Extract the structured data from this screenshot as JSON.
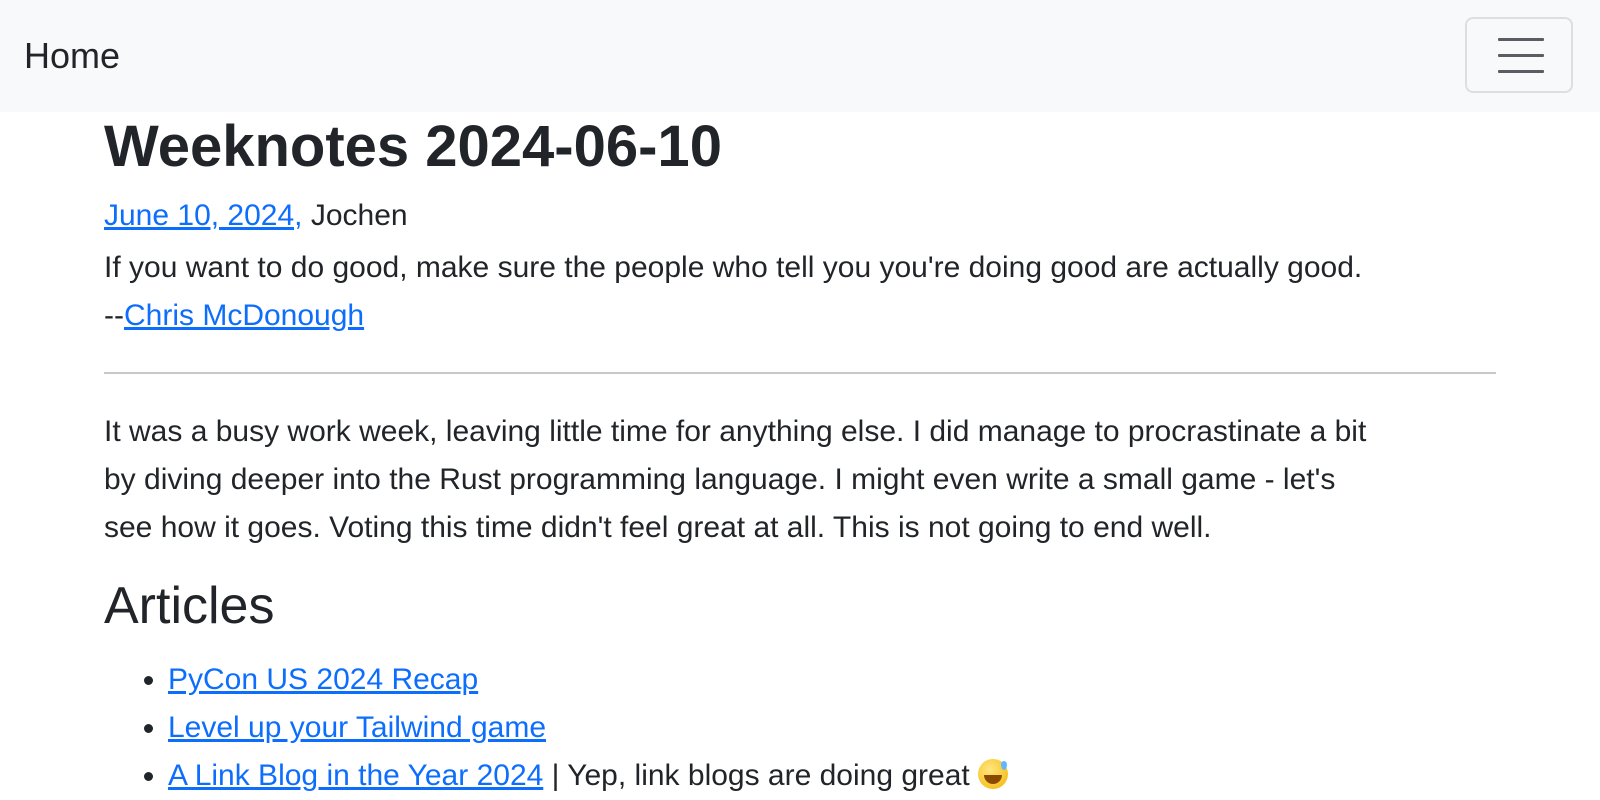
{
  "navbar": {
    "brand": "Home",
    "toggler_icon": "hamburger-menu-icon"
  },
  "post": {
    "title": "Weeknotes 2024-06-10",
    "date_link": "June 10, 2024,",
    "author": "Jochen",
    "quote_text": "If you want to do good, make sure the people who tell you you're doing good are actually good.",
    "quote_prefix": "--",
    "quote_author": "Chris McDonough",
    "paragraph_lines": [
      "It was a busy work week, leaving little time for anything else. I did manage to procrastinate a bit",
      "by diving deeper into the Rust programming language. I might even write a small game - let's",
      "see how it goes. Voting this time didn't feel great at all. This is not going to end well."
    ]
  },
  "articles": {
    "heading": "Articles",
    "items": [
      {
        "link": "PyCon US 2024 Recap",
        "note": ""
      },
      {
        "link": "Level up your Tailwind game",
        "note": ""
      },
      {
        "link": "A Link Blog in the Year 2024",
        "note": " | Yep, link blogs are doing great ",
        "emoji": "grinning-sweat-emoji"
      }
    ]
  }
}
